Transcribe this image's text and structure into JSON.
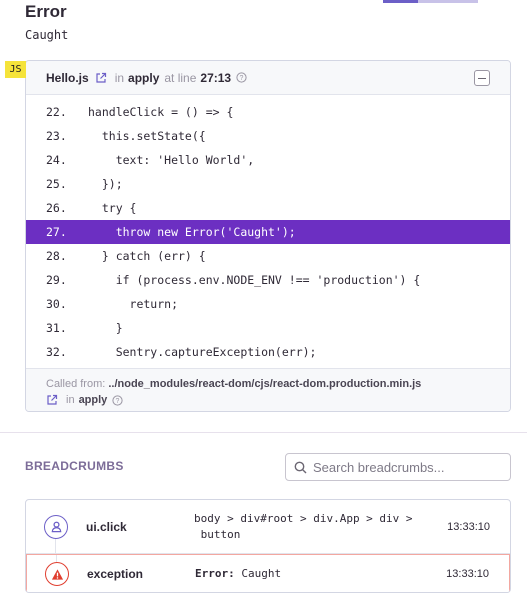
{
  "header": {
    "title": "Error",
    "subtitle": "Caught"
  },
  "frame": {
    "badge": "JS",
    "file": "Hello.js",
    "in_text": "in",
    "function": "apply",
    "at_line_text": "at line",
    "line_col": "27:13",
    "lines": [
      {
        "num": "22.",
        "code": "handleClick = () => {",
        "active": false
      },
      {
        "num": "23.",
        "code": "  this.setState({",
        "active": false
      },
      {
        "num": "24.",
        "code": "    text: 'Hello World',",
        "active": false
      },
      {
        "num": "25.",
        "code": "  });",
        "active": false
      },
      {
        "num": "26.",
        "code": "  try {",
        "active": false
      },
      {
        "num": "27.",
        "code": "    throw new Error('Caught');",
        "active": true
      },
      {
        "num": "28.",
        "code": "  } catch (err) {",
        "active": false
      },
      {
        "num": "29.",
        "code": "    if (process.env.NODE_ENV !== 'production') {",
        "active": false
      },
      {
        "num": "30.",
        "code": "      return;",
        "active": false
      },
      {
        "num": "31.",
        "code": "    }",
        "active": false
      },
      {
        "num": "32.",
        "code": "    Sentry.captureException(err);",
        "active": false
      }
    ],
    "called_from_label": "Called from:",
    "called_from_path": "../node_modules/react-dom/cjs/react-dom.production.min.js",
    "called_from_in": "in",
    "called_from_function": "apply"
  },
  "breadcrumbs": {
    "title": "BREADCRUMBS",
    "search_placeholder": "Search breadcrumbs...",
    "rows": [
      {
        "type": "ui.click",
        "message_line1": "body > div#root > div.App > div >",
        "message_line2": " button",
        "time": "13:33:10"
      },
      {
        "type": "exception",
        "message_label": "Error:",
        "message_value": " Caught",
        "time": "13:33:10"
      }
    ]
  },
  "colors": {
    "accent": "#6c5fc7",
    "highlight": "#6c2fc2",
    "error": "#e03e2f",
    "badge": "#f5e33a"
  }
}
